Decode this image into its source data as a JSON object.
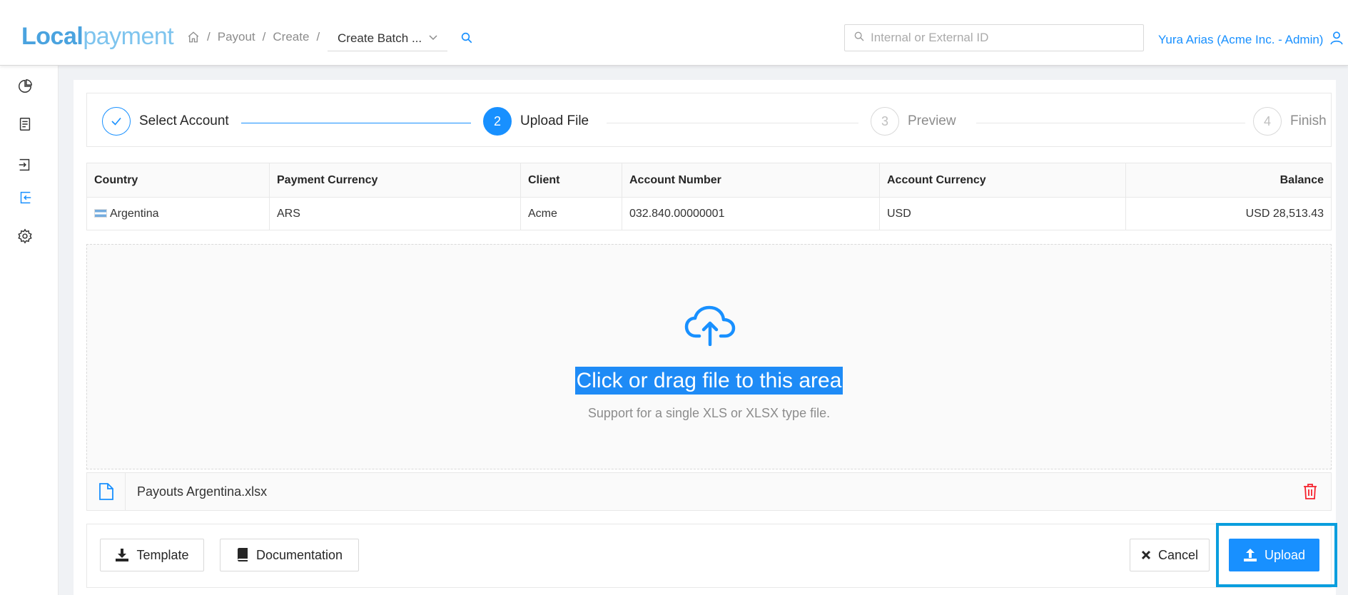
{
  "header": {
    "logo_part1": "Local",
    "logo_part2": "payment",
    "breadcrumbs": [
      "Payout",
      "Create"
    ],
    "batch_select_value": "Create Batch ...",
    "search_placeholder": "Internal or External ID",
    "user_label": "Yura Arias (Acme Inc. - Admin)"
  },
  "sidebar": {
    "icons": [
      "pie-chart-icon",
      "document-list-icon",
      "login-icon",
      "logout-icon",
      "settings-icon"
    ],
    "active_index": 3
  },
  "steps": [
    {
      "number": "1",
      "label": "Select Account",
      "state": "done"
    },
    {
      "number": "2",
      "label": "Upload File",
      "state": "active"
    },
    {
      "number": "3",
      "label": "Preview",
      "state": "pending"
    },
    {
      "number": "4",
      "label": "Finish",
      "state": "pending"
    }
  ],
  "account_table": {
    "columns": [
      "Country",
      "Payment Currency",
      "Client",
      "Account Number",
      "Account Currency",
      "Balance"
    ],
    "rows": [
      [
        "Argentina",
        "ARS",
        "Acme",
        "032.840.00000001",
        "USD",
        "USD 28,513.43"
      ]
    ]
  },
  "dropzone": {
    "title": "Click or drag file to this area",
    "hint": "Support for a single XLS or XLSX type file."
  },
  "file": {
    "name": "Payouts Argentina.xlsx"
  },
  "actions": {
    "template_label": "Template",
    "documentation_label": "Documentation",
    "cancel_label": "Cancel",
    "upload_label": "Upload"
  },
  "colors": {
    "primary": "#1890ff",
    "danger": "#f5222d",
    "highlight": "#0a9ede"
  }
}
